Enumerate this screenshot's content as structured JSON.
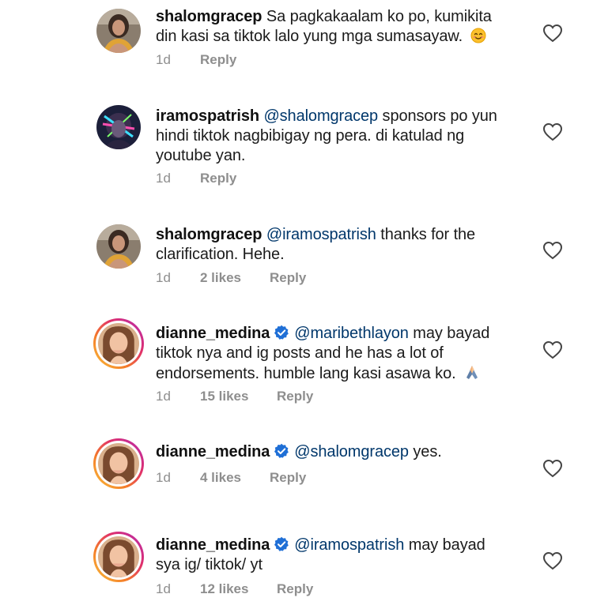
{
  "comments": [
    {
      "username": "shalomgracep",
      "verified": false,
      "mention": "",
      "text": "Sa pagkakaalam ko po, kumikita din kasi sa tiktok lalo yung mga sumasayaw.",
      "emoji": "smiling-face-emoji",
      "age": "1d",
      "likes": "",
      "reply_label": "Reply"
    },
    {
      "username": "iramospatrish",
      "verified": false,
      "mention": "@shalomgracep",
      "text": "sponsors po yun hindi tiktok nagbibigay ng pera. di katulad ng youtube yan.",
      "emoji": "",
      "age": "1d",
      "likes": "",
      "reply_label": "Reply"
    },
    {
      "username": "shalomgracep",
      "verified": false,
      "mention": "@iramospatrish",
      "text": "thanks for the clarification. Hehe.",
      "emoji": "",
      "age": "1d",
      "likes": "2 likes",
      "reply_label": "Reply"
    },
    {
      "username": "dianne_medina",
      "verified": true,
      "mention": "@maribethlayon",
      "text": "may bayad tiktok nya and ig posts and he has a lot of endorsements. humble lang kasi asawa ko.",
      "emoji": "folded-hands-emoji",
      "age": "1d",
      "likes": "15 likes",
      "reply_label": "Reply"
    },
    {
      "username": "dianne_medina",
      "verified": true,
      "mention": "@shalomgracep",
      "text": "yes.",
      "emoji": "",
      "age": "1d",
      "likes": "4 likes",
      "reply_label": "Reply"
    },
    {
      "username": "dianne_medina",
      "verified": true,
      "mention": "@iramospatrish",
      "text": "may bayad sya ig/ tiktok/ yt",
      "emoji": "",
      "age": "1d",
      "likes": "12 likes",
      "reply_label": "Reply"
    }
  ],
  "icons": {
    "like": "heart-outline-icon",
    "verified": "verified-badge-icon"
  },
  "colors": {
    "mention": "#00376b",
    "meta": "#8e8e8e",
    "verified": "#1f6fd6",
    "story_ring": "#e0306b"
  }
}
